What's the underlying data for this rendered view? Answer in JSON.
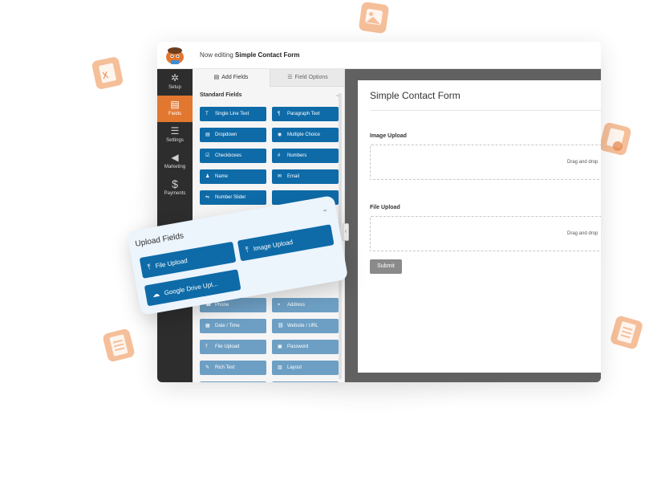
{
  "header": {
    "editing_prefix": "Now editing",
    "form_name": "Simple Contact Form"
  },
  "nav": {
    "items": [
      {
        "label": "Setup",
        "icon": "gear-icon"
      },
      {
        "label": "Fields",
        "icon": "fields-icon",
        "active": true
      },
      {
        "label": "Settings",
        "icon": "sliders-icon"
      },
      {
        "label": "Marketing",
        "icon": "megaphone-icon"
      },
      {
        "label": "Payments",
        "icon": "dollar-icon"
      }
    ]
  },
  "panel": {
    "tabs": {
      "add_fields": "Add Fields",
      "field_options": "Field Options"
    },
    "section_title": "Standard Fields",
    "standard_fields": [
      {
        "label": "Single Line Text",
        "icon": "T"
      },
      {
        "label": "Paragraph Text",
        "icon": "¶"
      },
      {
        "label": "Dropdown",
        "icon": "▤"
      },
      {
        "label": "Multiple Choice",
        "icon": "◉"
      },
      {
        "label": "Checkboxes",
        "icon": "☑"
      },
      {
        "label": "Numbers",
        "icon": "#"
      },
      {
        "label": "Name",
        "icon": "♟"
      },
      {
        "label": "Email",
        "icon": "✉"
      },
      {
        "label": "Number Slider",
        "icon": "⇋"
      }
    ],
    "faded_fields": [
      {
        "label": "Phone",
        "icon": "☎"
      },
      {
        "label": "Address",
        "icon": "⌖"
      },
      {
        "label": "Date / Time",
        "icon": "▦"
      },
      {
        "label": "Website / URL",
        "icon": "⛓"
      },
      {
        "label": "File Upload",
        "icon": "⤒"
      },
      {
        "label": "Password",
        "icon": "▣"
      },
      {
        "label": "Rich Text",
        "icon": "✎"
      },
      {
        "label": "Layout",
        "icon": "▥"
      }
    ]
  },
  "form": {
    "title": "Simple Contact Form",
    "fields": [
      {
        "label": "Image Upload",
        "drop_text": "Drag and drop"
      },
      {
        "label": "File Upload",
        "drop_text": "Drag and drop"
      }
    ],
    "submit_label": "Submit"
  },
  "upload_card": {
    "title": "Upload Fields",
    "buttons": [
      {
        "label": "File Upload",
        "icon": "⤒"
      },
      {
        "label": "Image Upload",
        "icon": "⤒"
      },
      {
        "label": "Google Drive Upl...",
        "icon": "☁"
      }
    ]
  },
  "colors": {
    "accent_orange": "#e27730",
    "button_blue": "#0e6ba8",
    "nav_dark": "#2d2d2d",
    "preview_gray": "#616161"
  }
}
